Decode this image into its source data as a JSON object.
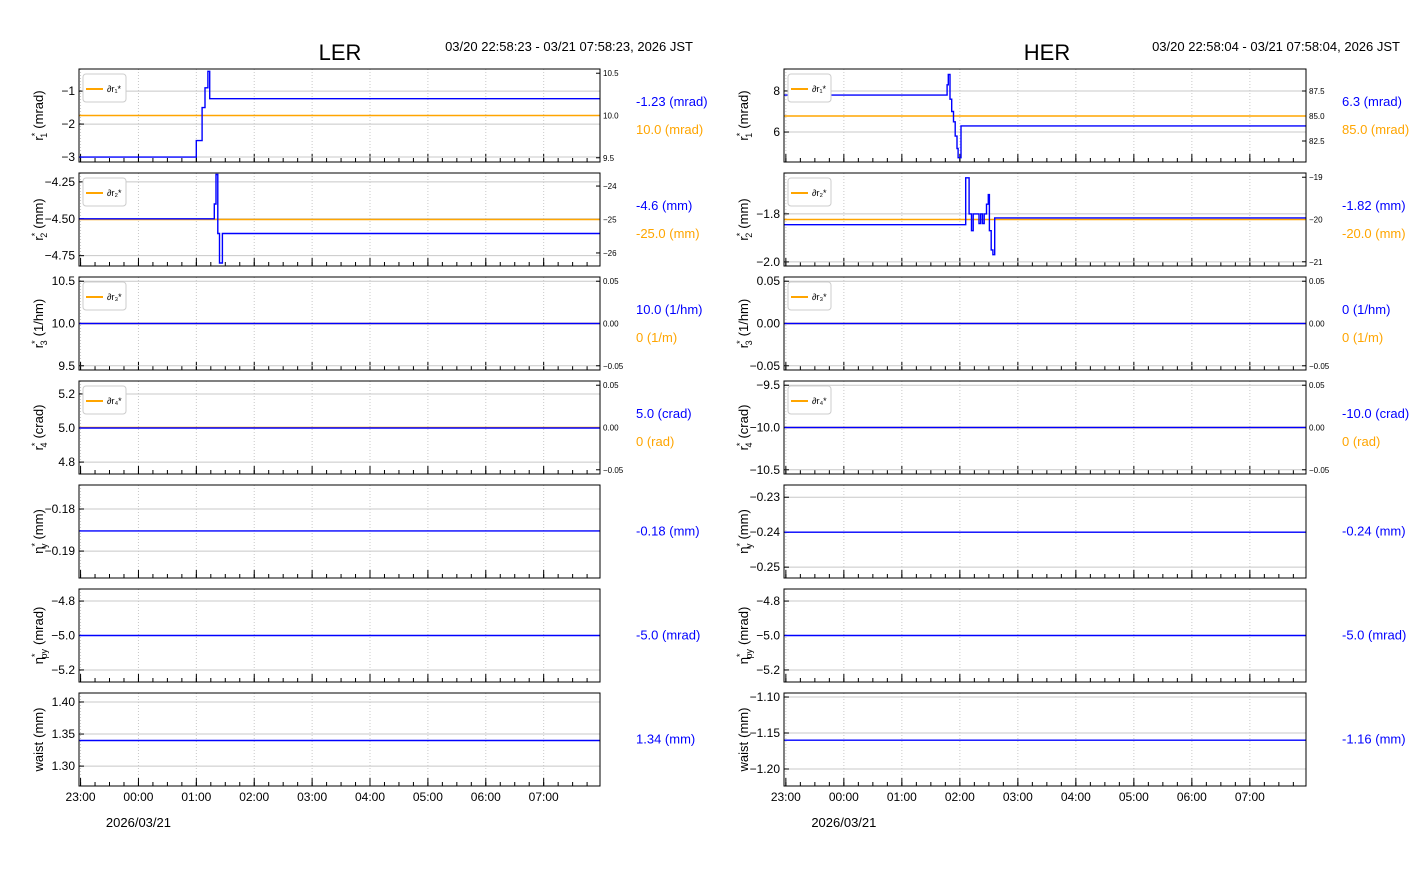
{
  "colors": {
    "blue": "#0000ff",
    "orange": "#ffa500",
    "grid": "#c8c8c8",
    "ref": "#d9a0a0"
  },
  "chart_data": [
    {
      "type": "line",
      "title": "LER",
      "range_text": "03/20 22:58:23 - 03/21 07:58:23, 2026 JST",
      "xlim": [
        -1.027,
        7.973
      ],
      "xticks": [
        -1,
        0,
        1,
        2,
        3,
        4,
        5,
        6,
        7
      ],
      "xtick_labels": [
        "23:00",
        "00:00",
        "01:00",
        "02:00",
        "03:00",
        "04:00",
        "05:00",
        "06:00",
        "07:00"
      ],
      "date_label": "2026/03/21",
      "panels": [
        {
          "ylabel": {
            "sym": "r",
            "sub": "1",
            "sup": "*",
            "unit": "(mrad)"
          },
          "ylim": [
            -3.15,
            -0.33
          ],
          "yticks": [
            -1,
            -2,
            -3
          ],
          "ytick_labels": [
            "−1",
            "−2",
            "−3"
          ],
          "right": {
            "ylim": [
              9.45,
              10.55
            ],
            "yticks": [
              10.5,
              10.0,
              9.5
            ],
            "ytick_labels": [
              "10.5",
              "10.0",
              "9.5"
            ],
            "orange": 10.0
          },
          "legend": "∂r₁*",
          "blue": [
            [
              -1.027,
              -3.0
            ],
            [
              1.0,
              -3.0
            ],
            [
              1.0,
              -2.5
            ],
            [
              1.1,
              -2.5
            ],
            [
              1.1,
              -1.5
            ],
            [
              1.15,
              -1.5
            ],
            [
              1.15,
              -0.9
            ],
            [
              1.2,
              -0.9
            ],
            [
              1.2,
              -0.4
            ],
            [
              1.23,
              -0.4
            ],
            [
              1.23,
              -1.23
            ],
            [
              7.973,
              -1.23
            ]
          ],
          "value_blue": "-1.23 (mrad)",
          "value_orange": "10.0 (mrad)"
        },
        {
          "ylabel": {
            "sym": "r",
            "sub": "2",
            "sup": "*",
            "unit": "(mm)"
          },
          "ylim": [
            -4.82,
            -4.19
          ],
          "yticks": [
            -4.25,
            -4.5,
            -4.75
          ],
          "ytick_labels": [
            "−4.25",
            "−4.50",
            "−4.75"
          ],
          "right": {
            "ylim": [
              -26.39,
              -23.61
            ],
            "yticks": [
              -24,
              -25,
              -26
            ],
            "ytick_labels": [
              "−24",
              "−25",
              "−26"
            ],
            "orange": -25.0
          },
          "legend": "∂r₂*",
          "blue": [
            [
              -1.027,
              -4.5
            ],
            [
              1.31,
              -4.5
            ],
            [
              1.31,
              -4.4
            ],
            [
              1.34,
              -4.4
            ],
            [
              1.34,
              -4.2
            ],
            [
              1.37,
              -4.2
            ],
            [
              1.37,
              -4.6
            ],
            [
              1.4,
              -4.6
            ],
            [
              1.4,
              -4.8
            ],
            [
              1.45,
              -4.8
            ],
            [
              1.45,
              -4.6
            ],
            [
              7.973,
              -4.6
            ]
          ],
          "value_blue": "-4.6 (mm)",
          "value_orange": "-25.0 (mm)"
        },
        {
          "ylabel": {
            "sym": "r",
            "sub": "3",
            "sup": "*",
            "unit": "(1/hm)"
          },
          "ylim": [
            9.45,
            10.55
          ],
          "yticks": [
            10.5,
            10.0,
            9.5
          ],
          "ytick_labels": [
            "10.5",
            "10.0",
            "9.5"
          ],
          "right": {
            "ylim": [
              -0.055,
              0.055
            ],
            "yticks": [
              0.05,
              0,
              -0.05
            ],
            "ytick_labels": [
              "0.05",
              "0.00",
              "−0.05"
            ],
            "orange": 0
          },
          "legend": "∂r₃*",
          "blue": [
            [
              -1.027,
              10.0
            ],
            [
              7.973,
              10.0
            ]
          ],
          "value_blue": "10.0 (1/hm)",
          "value_orange": "0 (1/m)"
        },
        {
          "ylabel": {
            "sym": "r",
            "sub": "4",
            "sup": "*",
            "unit": "(crad)"
          },
          "ylim": [
            4.73,
            5.276
          ],
          "yticks": [
            5.2,
            5.0,
            4.8
          ],
          "ytick_labels": [
            "5.2",
            "5.0",
            "4.8"
          ],
          "right": {
            "ylim": [
              -0.055,
              0.055
            ],
            "yticks": [
              0.05,
              0,
              -0.05
            ],
            "ytick_labels": [
              "0.05",
              "0.00",
              "−0.05"
            ],
            "orange": 0
          },
          "legend": "∂r₄*",
          "blue": [
            [
              -1.027,
              5.0
            ],
            [
              7.973,
              5.0
            ]
          ],
          "value_blue": "5.0 (crad)",
          "value_orange": "0 (rad)"
        },
        {
          "ylabel": {
            "sym": "η",
            "sub": "y",
            "sup": "*",
            "unit": "(mm)"
          },
          "ylim": [
            -0.1964,
            -0.1743
          ],
          "yticks": [
            -0.18,
            -0.19
          ],
          "ytick_labels": [
            "−0.18",
            "−0.19"
          ],
          "blue": [
            [
              -1.027,
              -0.1852
            ],
            [
              7.973,
              -0.1852
            ]
          ],
          "value_blue": "-0.18 (mm)"
        },
        {
          "ylabel": {
            "sym": "η",
            "sub": "py",
            "sup": "*",
            "unit": "(mrad)"
          },
          "ylim": [
            -5.27,
            -4.73
          ],
          "yticks": [
            -4.8,
            -5.0,
            -5.2
          ],
          "ytick_labels": [
            "−4.8",
            "−5.0",
            "−5.2"
          ],
          "blue": [
            [
              -1.027,
              -5.0
            ],
            [
              7.973,
              -5.0
            ]
          ],
          "value_blue": "-5.0 (mrad)"
        },
        {
          "ylabel": {
            "sym": "waist",
            "sub": "",
            "sup": "",
            "unit": "(mm)"
          },
          "ylim": [
            1.269,
            1.414
          ],
          "yticks": [
            1.4,
            1.35,
            1.3
          ],
          "ytick_labels": [
            "1.40",
            "1.35",
            "1.30"
          ],
          "blue": [
            [
              -1.027,
              1.34
            ],
            [
              7.973,
              1.34
            ]
          ],
          "value_blue": "1.34 (mm)"
        }
      ]
    },
    {
      "type": "line",
      "title": "HER",
      "range_text": "03/20 22:58:04 - 03/21 07:58:04, 2026 JST",
      "xlim": [
        -1.032,
        7.968
      ],
      "xticks": [
        -1,
        0,
        1,
        2,
        3,
        4,
        5,
        6,
        7
      ],
      "xtick_labels": [
        "23:00",
        "00:00",
        "01:00",
        "02:00",
        "03:00",
        "04:00",
        "05:00",
        "06:00",
        "07:00"
      ],
      "date_label": "2026/03/21",
      "panels": [
        {
          "ylabel": {
            "sym": "r",
            "sub": "1",
            "sup": "*",
            "unit": "(mrad)"
          },
          "ylim": [
            4.54,
            9.07
          ],
          "yticks": [
            8,
            6
          ],
          "ytick_labels": [
            "8",
            "6"
          ],
          "right": {
            "ylim": [
              80.4,
              89.7
            ],
            "yticks": [
              87.5,
              85.0,
              82.5
            ],
            "ytick_labels": [
              "87.5",
              "85.0",
              "82.5"
            ],
            "orange": 85.0
          },
          "legend": "∂r₁*",
          "blue": [
            [
              -1.032,
              7.8
            ],
            [
              1.78,
              7.8
            ],
            [
              1.78,
              8.3
            ],
            [
              1.8,
              8.3
            ],
            [
              1.8,
              8.8
            ],
            [
              1.83,
              8.8
            ],
            [
              1.83,
              7.6
            ],
            [
              1.86,
              7.6
            ],
            [
              1.86,
              7.0
            ],
            [
              1.89,
              7.0
            ],
            [
              1.89,
              6.5
            ],
            [
              1.92,
              6.5
            ],
            [
              1.92,
              5.8
            ],
            [
              1.95,
              5.8
            ],
            [
              1.95,
              5.2
            ],
            [
              1.97,
              5.2
            ],
            [
              1.97,
              4.75
            ],
            [
              2.02,
              4.75
            ],
            [
              2.02,
              6.3
            ],
            [
              7.968,
              6.3
            ]
          ],
          "value_blue": "6.3 (mrad)",
          "value_orange": "85.0 (mrad)"
        },
        {
          "ylabel": {
            "sym": "r",
            "sub": "2",
            "sup": "*",
            "unit": "(mm)"
          },
          "ylim": [
            -2.017,
            -1.63
          ],
          "yticks": [
            -1.8,
            -2.0
          ],
          "ytick_labels": [
            "−1.8",
            "−2.0"
          ],
          "right": {
            "ylim": [
              -21.1,
              -18.9
            ],
            "yticks": [
              -19,
              -20,
              -21
            ],
            "ytick_labels": [
              "−19",
              "−20",
              "−21"
            ],
            "orange": -20.0
          },
          "legend": "∂r₂*",
          "blue": [
            [
              -1.032,
              -1.845
            ],
            [
              2.1,
              -1.845
            ],
            [
              2.1,
              -1.65
            ],
            [
              2.16,
              -1.65
            ],
            [
              2.16,
              -1.8
            ],
            [
              2.2,
              -1.8
            ],
            [
              2.2,
              -1.87
            ],
            [
              2.23,
              -1.87
            ],
            [
              2.23,
              -1.8
            ],
            [
              2.33,
              -1.8
            ],
            [
              2.33,
              -1.84
            ],
            [
              2.36,
              -1.84
            ],
            [
              2.36,
              -1.8
            ],
            [
              2.39,
              -1.8
            ],
            [
              2.39,
              -1.84
            ],
            [
              2.42,
              -1.84
            ],
            [
              2.42,
              -1.8
            ],
            [
              2.46,
              -1.8
            ],
            [
              2.46,
              -1.76
            ],
            [
              2.49,
              -1.76
            ],
            [
              2.49,
              -1.72
            ],
            [
              2.51,
              -1.72
            ],
            [
              2.51,
              -1.87
            ],
            [
              2.54,
              -1.87
            ],
            [
              2.54,
              -1.95
            ],
            [
              2.57,
              -1.95
            ],
            [
              2.57,
              -1.97
            ],
            [
              2.6,
              -1.97
            ],
            [
              2.6,
              -1.817
            ],
            [
              7.968,
              -1.817
            ]
          ],
          "value_blue": "-1.82 (mm)",
          "value_orange": "-20.0 (mm)"
        },
        {
          "ylabel": {
            "sym": "r",
            "sub": "3",
            "sup": "*",
            "unit": "(1/hm)"
          },
          "ylim": [
            -0.055,
            0.055
          ],
          "yticks": [
            0.05,
            0,
            -0.05
          ],
          "ytick_labels": [
            "0.05",
            "0.00",
            "−0.05"
          ],
          "right": {
            "ylim": [
              -0.055,
              0.055
            ],
            "yticks": [
              0.05,
              0,
              -0.05
            ],
            "ytick_labels": [
              "0.05",
              "0.00",
              "−0.05"
            ],
            "orange": 0
          },
          "legend": "∂r₃*",
          "blue": [
            [
              -1.032,
              0
            ],
            [
              7.968,
              0
            ]
          ],
          "value_blue": "0 (1/hm)",
          "value_orange": "0 (1/m)"
        },
        {
          "ylabel": {
            "sym": "r",
            "sub": "4",
            "sup": "*",
            "unit": "(crad)"
          },
          "ylim": [
            -10.55,
            -9.45
          ],
          "yticks": [
            -9.5,
            -10.0,
            -10.5
          ],
          "ytick_labels": [
            "−9.5",
            "−10.0",
            "−10.5"
          ],
          "right": {
            "ylim": [
              -0.055,
              0.055
            ],
            "yticks": [
              0.05,
              0,
              -0.05
            ],
            "ytick_labels": [
              "0.05",
              "0.00",
              "−0.05"
            ],
            "orange": 0
          },
          "legend": "∂r₄*",
          "blue": [
            [
              -1.032,
              -10.0
            ],
            [
              7.968,
              -10.0
            ]
          ],
          "value_blue": "-10.0 (crad)",
          "value_orange": "0 (rad)"
        },
        {
          "ylabel": {
            "sym": "η",
            "sub": "y",
            "sup": "*",
            "unit": "(mm)"
          },
          "ylim": [
            -0.2531,
            -0.2265
          ],
          "yticks": [
            -0.23,
            -0.24,
            -0.25
          ],
          "ytick_labels": [
            "−0.23",
            "−0.24",
            "−0.25"
          ],
          "blue": [
            [
              -1.032,
              -0.24
            ],
            [
              7.968,
              -0.24
            ]
          ],
          "value_blue": "-0.24 (mm)"
        },
        {
          "ylabel": {
            "sym": "η",
            "sub": "py",
            "sup": "*",
            "unit": "(mrad)"
          },
          "ylim": [
            -5.27,
            -4.73
          ],
          "yticks": [
            -4.8,
            -5.0,
            -5.2
          ],
          "ytick_labels": [
            "−4.8",
            "−5.0",
            "−5.2"
          ],
          "blue": [
            [
              -1.032,
              -5.0
            ],
            [
              7.968,
              -5.0
            ]
          ],
          "value_blue": "-5.0 (mrad)"
        },
        {
          "ylabel": {
            "sym": "waist",
            "sub": "",
            "sup": "",
            "unit": "(mm)"
          },
          "ylim": [
            -1.2236,
            -1.0944
          ],
          "yticks": [
            -1.1,
            -1.15,
            -1.2
          ],
          "ytick_labels": [
            "−1.10",
            "−1.15",
            "−1.20"
          ],
          "blue": [
            [
              -1.032,
              -1.16
            ],
            [
              7.968,
              -1.16
            ]
          ],
          "value_blue": "-1.16 (mm)"
        }
      ]
    }
  ]
}
